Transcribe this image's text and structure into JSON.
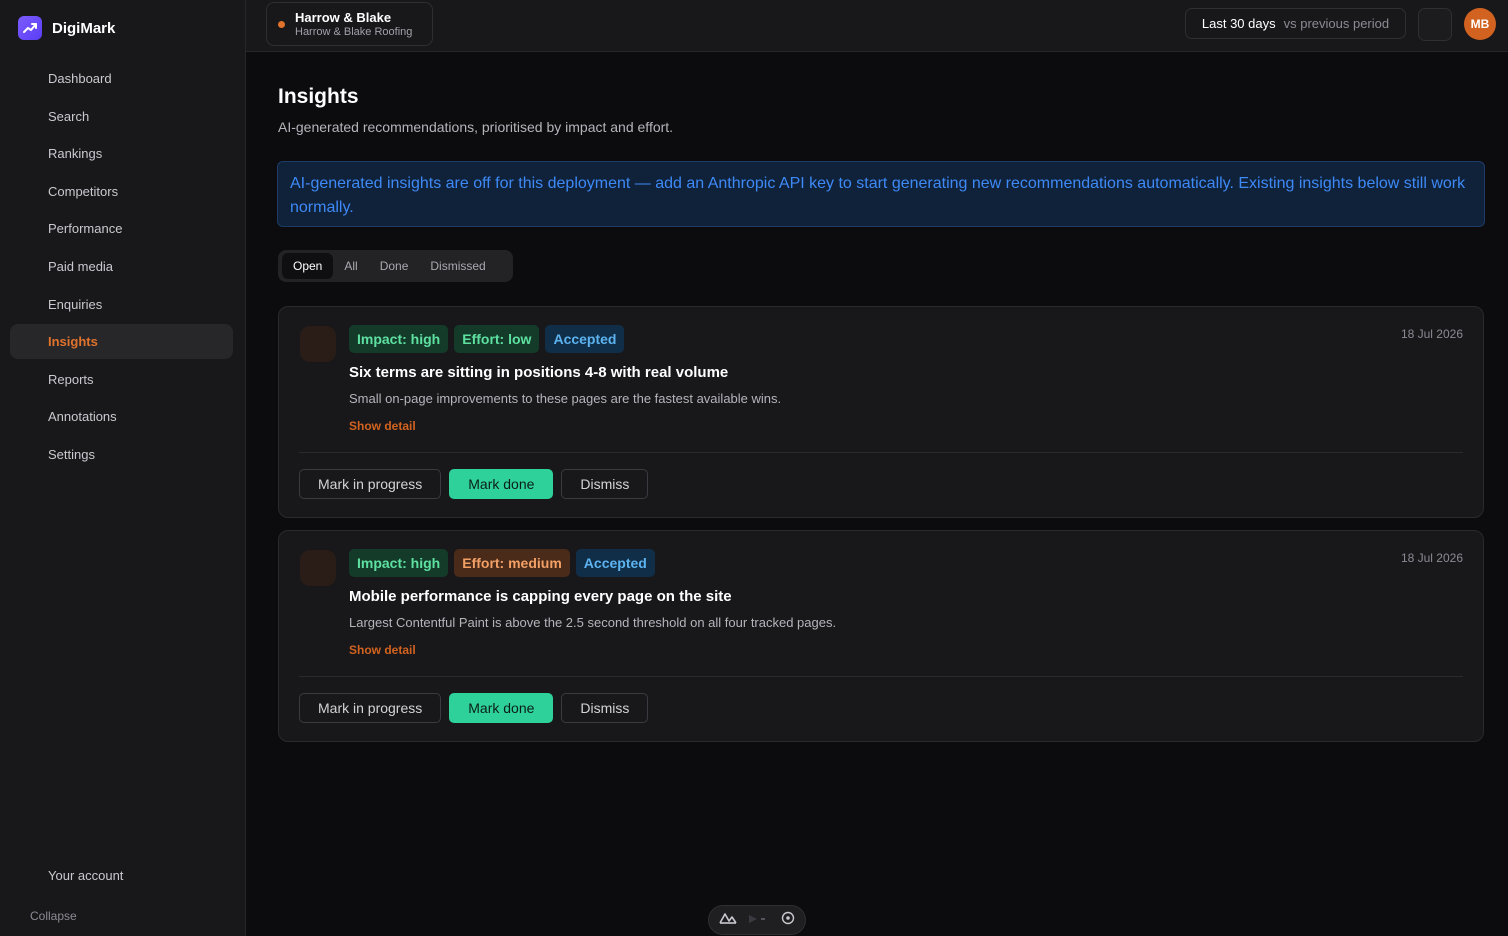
{
  "brand": {
    "name": "DigiMark"
  },
  "sidebar": {
    "items": [
      {
        "label": "Dashboard"
      },
      {
        "label": "Search"
      },
      {
        "label": "Rankings"
      },
      {
        "label": "Competitors"
      },
      {
        "label": "Performance"
      },
      {
        "label": "Paid media"
      },
      {
        "label": "Enquiries"
      },
      {
        "label": "Insights",
        "active": true
      },
      {
        "label": "Reports"
      },
      {
        "label": "Annotations"
      },
      {
        "label": "Settings"
      }
    ],
    "account_label": "Your account",
    "collapse_label": "Collapse"
  },
  "topbar": {
    "client_name": "Harrow & Blake",
    "client_sub": "Harrow & Blake Roofing",
    "period_main": "Last 30 days",
    "period_sub": "vs previous period",
    "avatar_initials": "MB"
  },
  "page": {
    "title": "Insights",
    "subtitle": "AI-generated recommendations, prioritised by impact and effort.",
    "banner": "AI-generated insights are off for this deployment — add an Anthropic API key to start generating new recommendations automatically. Existing insights below still work normally."
  },
  "tabs": [
    {
      "label": "Open",
      "active": true
    },
    {
      "label": "All"
    },
    {
      "label": "Done"
    },
    {
      "label": "Dismissed"
    }
  ],
  "insights": [
    {
      "impact": "Impact: high",
      "effort": "Effort: low",
      "status": "Accepted",
      "date": "18 Jul 2026",
      "title": "Six terms are sitting in positions 4-8 with real volume",
      "description": "Small on-page improvements to these pages are the fastest available wins.",
      "show_detail": "Show detail",
      "actions": {
        "progress": "Mark in progress",
        "done": "Mark done",
        "dismiss": "Dismiss"
      }
    },
    {
      "impact": "Impact: high",
      "effort": "Effort: medium",
      "status": "Accepted",
      "date": "18 Jul 2026",
      "title": "Mobile performance is capping every page on the site",
      "description": "Largest Contentful Paint is above the 2.5 second threshold on all four tracked pages.",
      "show_detail": "Show detail",
      "actions": {
        "progress": "Mark in progress",
        "done": "Mark done",
        "dismiss": "Dismiss"
      }
    }
  ],
  "colors": {
    "accent": "#e0722c",
    "primary_button": "#2fd19a",
    "banner_text": "#3d8af7"
  }
}
